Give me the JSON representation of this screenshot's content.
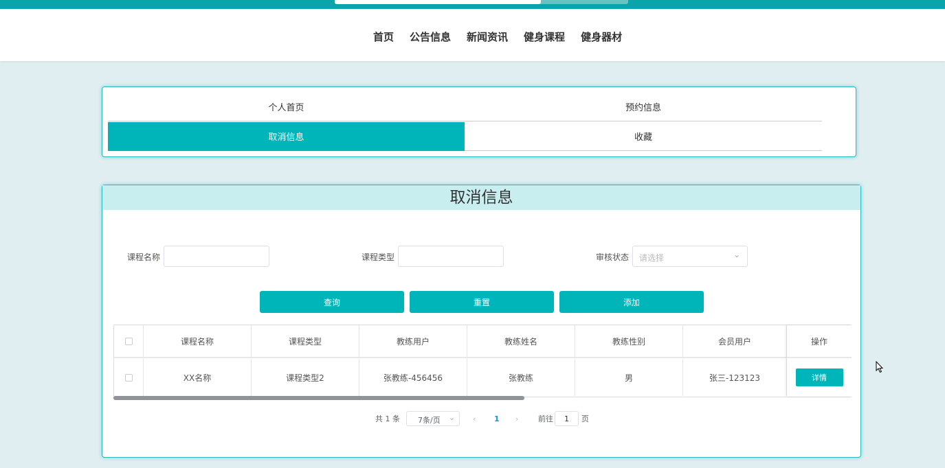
{
  "nav": {
    "items": [
      "首页",
      "公告信息",
      "新闻资讯",
      "健身课程",
      "健身器材"
    ]
  },
  "tabs": {
    "items": [
      "个人首页",
      "预约信息",
      "取消信息",
      "收藏"
    ],
    "active": "取消信息"
  },
  "panel": {
    "title": "取消信息"
  },
  "search": {
    "course_name_label": "课程名称",
    "course_type_label": "课程类型",
    "status_label": "审核状态",
    "status_placeholder": "请选择"
  },
  "actions": {
    "query": "查询",
    "reset": "重置",
    "add": "添加"
  },
  "table": {
    "headers": [
      "课程名称",
      "课程类型",
      "教练用户",
      "教练姓名",
      "教练性别",
      "会员用户",
      "操作"
    ],
    "rows": [
      {
        "cells": [
          "XX名称",
          "课程类型2",
          "张教练-456456",
          "张教练",
          "男",
          "张三-123123"
        ],
        "action": "详情"
      }
    ]
  },
  "pagination": {
    "total": "共 1 条",
    "page_size": "7条/页",
    "current_page": "1",
    "goto_label": "前往",
    "goto_value": "1",
    "page_suffix": "页"
  },
  "colors": {
    "accent": "#00b5b9",
    "page_bg": "#e0eef1",
    "header_bg": "#c9eef0"
  }
}
